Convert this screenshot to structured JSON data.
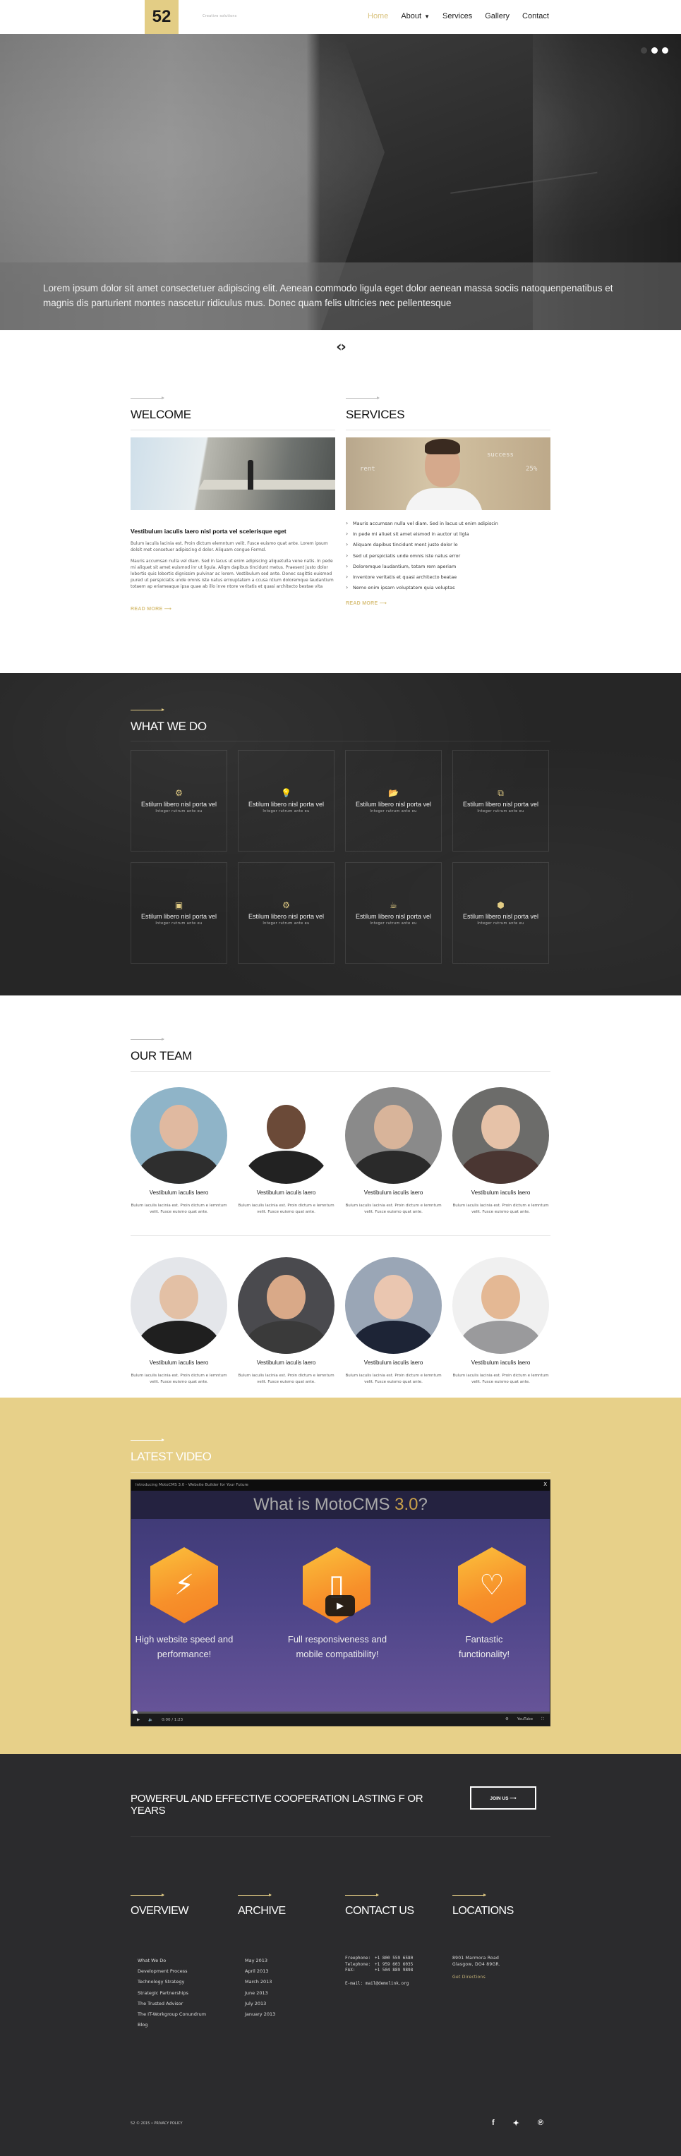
{
  "header": {
    "logo": "52",
    "tagline": "Creative solutions",
    "nav": [
      {
        "label": "Home",
        "active": true
      },
      {
        "label": "About",
        "has_dropdown": true
      },
      {
        "label": "Services"
      },
      {
        "label": "Gallery"
      },
      {
        "label": "Contact"
      }
    ]
  },
  "hero": {
    "caption": "Lorem ipsum dolor sit amet consectetuer adipiscing elit. Aenean commodo ligula eget dolor aenean massa sociis natoquenpenatibus et magnis dis parturient montes nascetur ridiculus mus. Donec quam felis ultricies nec pellentesque",
    "slides_count": 3,
    "active_slide": 1,
    "prev_icon": "‹",
    "next_icon": "›"
  },
  "welcome": {
    "title": "WELCOME",
    "subtitle": "Vestibulum iaculis laero nisl porta vel scelerisque eget",
    "paragraph1": "Bulum iaculis lacinia est. Proin dictum elemntum velit. Fusce euismo quat ante. Lorem ipsum dolsit met consetuer adipiscing d dolor. Aliquam congue Fermsl.",
    "paragraph2": "Mauris accumsan nulla vel diam. Sed in lacus ut enim adipiscing aliquetulla vene natis. In pede mi aliquet sit amet euismod inr ut ligula. Aliqm dapibus tincidunt metus. Praesent justo dolor lobortis quis lobortis dignissim pulvinar ac lorem. Vestibulum sed ante. Donec sagittis euismod pured ut perspiciatis unde omnis iste natus errouptatem a ccusa ntium doloremque laudantium totaem ap eriameaque ipsa quae ab illo inve ntore veritatis et quasi architecto bestae vita",
    "read_more": "READ MORE ⟶"
  },
  "services": {
    "title": "SERVICES",
    "items": [
      "Mauris accumsan nulla vel diam. Sed in lacus ut enim adipiscin",
      "In pede mi aliuet sit amet eismod in auctor ut ligla",
      "Aliquam dapibus tincidunt ment justo dolor lo",
      "Sed ut perspiciatis unde omnis iste natus error",
      "Doloremque laudantium, totam rem aperiam",
      "Inventore veritatis et quasi architecto beatae",
      "Nemo enim ipsam voluptatem quia voluptas"
    ],
    "read_more": "READ MORE ⟶"
  },
  "what_we_do": {
    "title": "WHAT WE DO",
    "cards": [
      {
        "icon": "⚙",
        "icon_name": "gear-icon",
        "title": "Estilum libero nisl porta vel",
        "subtitle": "Integer rutrum ante eu"
      },
      {
        "icon": "💡",
        "icon_name": "lightbulb-icon",
        "title": "Estilum libero nisl porta vel",
        "subtitle": "Integer rutrum ante eu"
      },
      {
        "icon": "📂",
        "icon_name": "folder-open-icon",
        "title": "Estilum libero nisl porta vel",
        "subtitle": "Integer rutrum ante eu"
      },
      {
        "icon": "⧉",
        "icon_name": "copy-icon",
        "title": "Estilum libero nisl porta vel",
        "subtitle": "Integer rutrum ante eu"
      },
      {
        "icon": "▣",
        "icon_name": "calendar-icon",
        "title": "Estilum libero nisl porta vel",
        "subtitle": "Integer rutrum ante eu"
      },
      {
        "icon": "⚙",
        "icon_name": "cogs-icon",
        "title": "Estilum libero nisl porta vel",
        "subtitle": "Integer rutrum ante eu"
      },
      {
        "icon": "☕",
        "icon_name": "coffee-icon",
        "title": "Estilum libero nisl porta vel",
        "subtitle": "Integer rutrum ante eu"
      },
      {
        "icon": "⬢",
        "icon_name": "cube-icon",
        "title": "Estilum libero nisl porta vel",
        "subtitle": "Integer rutrum ante eu"
      }
    ]
  },
  "team": {
    "title": "OUR TEAM",
    "members": [
      {
        "name": "Vestibulum iaculis laero",
        "desc": "Bulum iaculis lacinia est. Proin dictum e lemntum velit. Fusce euismo quat ante.",
        "bg": "#8fb4c8",
        "skin": "#e0b9a0",
        "suit": "#2e2e2e"
      },
      {
        "name": "Vestibulum iaculis laero",
        "desc": "Bulum iaculis lacinia est. Proin dictum e lemntum velit. Fusce euismo quat ante.",
        "bg": "#ffffff",
        "skin": "#6b4a38",
        "suit": "#222222"
      },
      {
        "name": "Vestibulum iaculis laero",
        "desc": "Bulum iaculis lacinia est. Proin dictum e lemntum velit. Fusce euismo quat ante.",
        "bg": "#8a8a8a",
        "skin": "#d8b49a",
        "suit": "#2a2a2a"
      },
      {
        "name": "Vestibulum iaculis laero",
        "desc": "Bulum iaculis lacinia est. Proin dictum e lemntum velit. Fusce euismo quat ante.",
        "bg": "#6c6c6a",
        "skin": "#e6c2a8",
        "suit": "#4a3632"
      },
      {
        "name": "Vestibulum iaculis laero",
        "desc": "Bulum iaculis lacinia est. Proin dictum e lemntum velit. Fusce euismo quat ante.",
        "bg": "#e4e6ea",
        "skin": "#e3c0a5",
        "suit": "#1f1f1f"
      },
      {
        "name": "Vestibulum iaculis laero",
        "desc": "Bulum iaculis lacinia est. Proin dictum e lemntum velit. Fusce euismo quat ante.",
        "bg": "#4a4a4e",
        "skin": "#d9a988",
        "suit": "#3a3a3a"
      },
      {
        "name": "Vestibulum iaculis laero",
        "desc": "Bulum iaculis lacinia est. Proin dictum e lemntum velit. Fusce euismo quat ante.",
        "bg": "#9aa6b6",
        "skin": "#eac6b0",
        "suit": "#1d2436"
      },
      {
        "name": "Vestibulum iaculis laero",
        "desc": "Bulum iaculis lacinia est. Proin dictum e lemntum velit. Fusce euismo quat ante.",
        "bg": "#f0f0f0",
        "skin": "#e4b894",
        "suit": "#9a9a9c"
      }
    ]
  },
  "video": {
    "title": "LATEST VIDEO",
    "player_title": "Introducing MotoCMS 3.0 - Website Builder for Your Future",
    "headline_main": "What is MotoCMS ",
    "headline_accent": "3.0",
    "headline_end": "?",
    "features": [
      {
        "icon": "⚡",
        "icon_name": "lightning-icon",
        "text": "High website speed and performance!"
      },
      {
        "icon": "▯",
        "icon_name": "mobile-icon",
        "text": "Full responsiveness and mobile compatibility!"
      },
      {
        "icon": "♡",
        "icon_name": "heart-icon",
        "text": "Fantastic functionality!"
      }
    ],
    "time": "0:00 / 1:23",
    "progress": 0,
    "close": "X"
  },
  "cta": {
    "text": "POWERFUL AND EFFECTIVE COOPERATION LASTING F OR YEARS",
    "button": "JOIN US ⟶"
  },
  "footer": {
    "overview": {
      "title": "OVERVIEW",
      "links": [
        "What We Do",
        "Development Process",
        "Technology Strategy",
        "Strategic Partnerships",
        "The Trusted Advisor",
        "The IT-Workgroup Conundrum",
        "Blog"
      ]
    },
    "archive": {
      "title": "ARCHIVE",
      "links": [
        "May 2013",
        "April 2013",
        "March 2013",
        "June 2013",
        "July 2013",
        "January 2013"
      ]
    },
    "contact": {
      "title": "CONTACT US",
      "freephone_label": "Freephone:",
      "freephone": "+1 800 559 6580",
      "telephone_label": "Telephone:",
      "telephone": "+1 959 603 6035",
      "fax_label": "FAX:",
      "fax": "+1 504 889 9898",
      "email": "E-mail: mail@demolink.org"
    },
    "locations": {
      "title": "LOCATIONS",
      "address1": "8901 Marmora Road",
      "address2": "Glasgow, DO4 89GR.",
      "directions": "Get Directions"
    },
    "copyright": "52 © 2015 • PRIVACY POLICY",
    "social": [
      {
        "name": "facebook-icon",
        "glyph": "f"
      },
      {
        "name": "twitter-icon",
        "glyph": "🐦"
      },
      {
        "name": "pinterest-icon",
        "glyph": "℗"
      }
    ]
  }
}
